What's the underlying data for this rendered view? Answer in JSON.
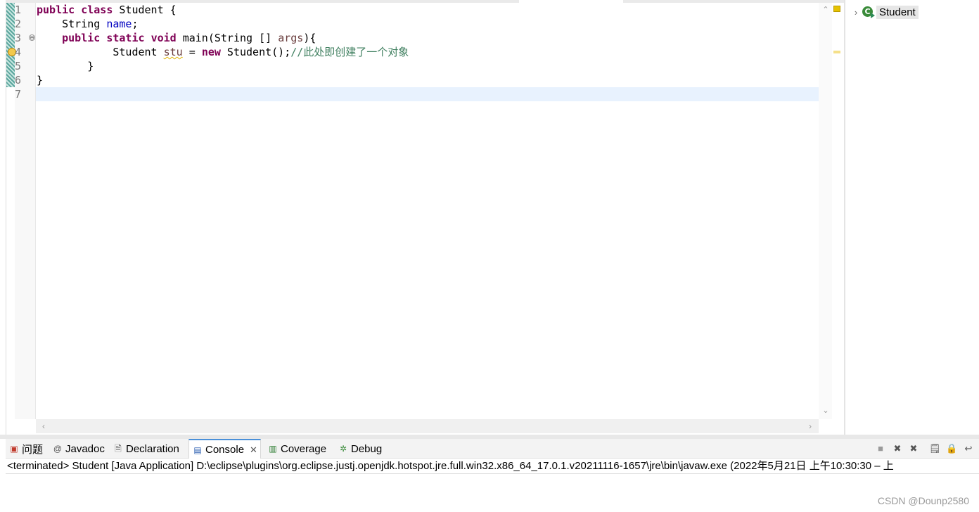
{
  "editor": {
    "lines": [
      {
        "num": "1"
      },
      {
        "num": "2"
      },
      {
        "num": "3"
      },
      {
        "num": "4"
      },
      {
        "num": "5"
      },
      {
        "num": "6"
      },
      {
        "num": "7"
      }
    ],
    "code": {
      "l1_kw1": "public",
      "l1_kw2": "class",
      "l1_text": " Student {",
      "l2_type": "    String ",
      "l2_field": "name",
      "l2_end": ";",
      "l3_kw1": "public",
      "l3_kw2": "static",
      "l3_kw3": "void",
      "l3_text": " main(String [] ",
      "l3_param": "args",
      "l3_end": "){",
      "l4_type": "            Student ",
      "l4_var": "stu",
      "l4_mid": " = ",
      "l4_kw": "new",
      "l4_text": " Student();",
      "l4_comment": "//此处即创建了一个对象",
      "l5_text": "        }",
      "l6_text": "}"
    },
    "fold_glyph": "⊖"
  },
  "outline": {
    "class_name": "Student",
    "class_icon_letter": "C"
  },
  "bottom": {
    "tabs": [
      {
        "label": "问题"
      },
      {
        "label": "Javadoc"
      },
      {
        "label": "Declaration"
      },
      {
        "label": "Console"
      },
      {
        "label": "Coverage"
      },
      {
        "label": "Debug"
      }
    ],
    "console_status": "<terminated> Student [Java Application] D:\\eclipse\\plugins\\org.eclipse.justj.openjdk.hotspot.jre.full.win32.x86_64_17.0.1.v20211116-1657\\jre\\bin\\javaw.exe  (2022年5月21日 上午10:30:30 – 上"
  },
  "watermark": "CSDN @Dounp2580",
  "colors": {
    "keyword": "#7f0055",
    "field": "#0000c0",
    "comment": "#3f7f5f",
    "current_line": "#e8f2fe",
    "active_tab_accent": "#4a90d9"
  }
}
